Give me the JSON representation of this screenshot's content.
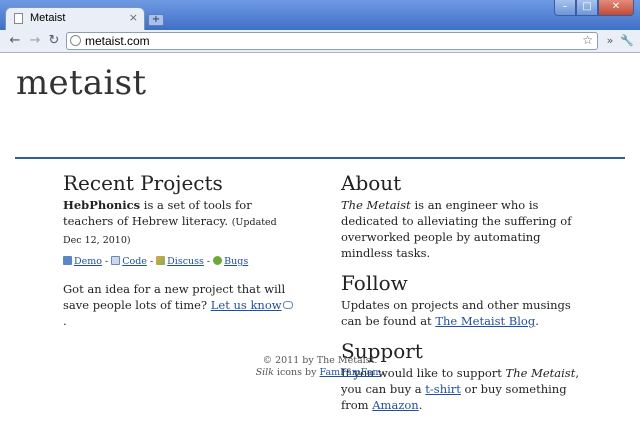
{
  "browser": {
    "tab_title": "Metaist",
    "tab_close": "×",
    "new_tab": "+",
    "window_buttons": {
      "minimize": "–",
      "maximize": "□",
      "close": "✕"
    },
    "nav": {
      "back": "←",
      "forward": "→",
      "reload": "↻"
    },
    "url": "metaist.com",
    "bookmark_icon": "star-icon",
    "overflow": "»",
    "menu": "🔧"
  },
  "page": {
    "site_title": "metaist",
    "recent_projects": {
      "heading": "Recent Projects",
      "project_name": "HebPhonics",
      "project_desc": " is a set of tools for teachers of Hebrew literacy. ",
      "updated": "(Updated Dec 12, 2010)",
      "links": {
        "demo": "Demo",
        "code": "Code",
        "discuss": "Discuss",
        "bugs": "Bugs",
        "sep": " - "
      },
      "idea_text": "Got an idea for a new project that will save people lots of time? ",
      "idea_link": "Let us know",
      "idea_end": "."
    },
    "about": {
      "heading": "About",
      "name": "The Metaist",
      "text": " is an engineer who is dedicated to alleviating the suffering of overworked people by automating mindless tasks."
    },
    "follow": {
      "heading": "Follow",
      "text": "Updates on projects and other musings can be found at ",
      "link": "The Metaist Blog",
      "end": "."
    },
    "support": {
      "heading": "Support",
      "text1": "If you would like to support ",
      "name": "The Metaist",
      "text2": ", you can buy a ",
      "tshirt": "t-shirt",
      "text3": " or buy something from ",
      "amazon": "Amazon",
      "end": "."
    },
    "footer": {
      "copyright": "© 2011 by The Metaist.",
      "silk": "Silk",
      "icons_by": " icons by ",
      "famfamfam": "FamFamFam",
      "end": "."
    }
  },
  "colors": {
    "accent_rule": "#2e5f99",
    "link": "#1f4f9e",
    "titlebar": "#4a7bd1"
  }
}
